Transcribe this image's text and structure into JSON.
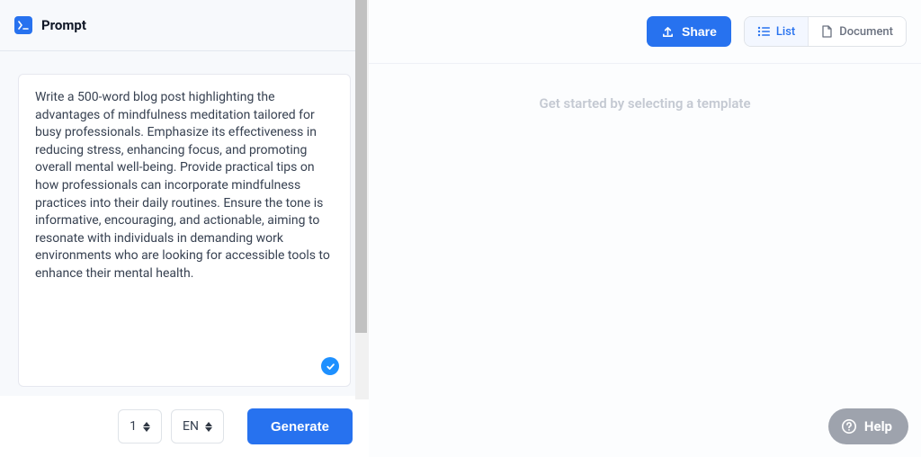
{
  "left": {
    "title": "Prompt",
    "prompt_text": "Write a 500-word blog post highlighting the advantages of mindfulness meditation tailored for busy professionals. Emphasize its effectiveness in reducing stress, enhancing focus, and promoting overall mental well-being. Provide practical tips on how professionals can incorporate mindfulness practices into their daily routines. Ensure the tone is informative, encouraging, and actionable, aiming to resonate with individuals in demanding work environments who are looking for accessible tools to enhance their mental health.",
    "quantity": "1",
    "language": "EN",
    "generate_label": "Generate"
  },
  "right": {
    "share_label": "Share",
    "list_label": "List",
    "document_label": "Document",
    "placeholder_text": "Get started by selecting a template",
    "help_label": "Help"
  }
}
